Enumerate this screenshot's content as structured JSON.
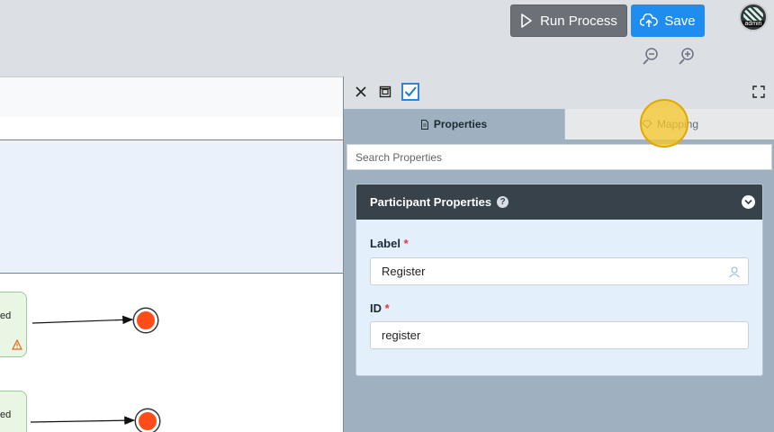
{
  "toolbar": {
    "run_label": "Run Process",
    "save_label": "Save",
    "avatar_label": "admin",
    "zoom_out": "zoom-out-icon",
    "zoom_in": "zoom-in-icon"
  },
  "canvas": {
    "task1_label": "ed",
    "task2_label": "ed"
  },
  "panel": {
    "tabs": [
      {
        "label": "Properties",
        "icon": "document-icon",
        "active": true
      },
      {
        "label": "Mapping",
        "icon": "mapping-icon",
        "active": false
      }
    ],
    "search_placeholder": "Search Properties",
    "section_title": "Participant Properties",
    "fields": [
      {
        "label": "Label",
        "required": "*",
        "value": "Register"
      },
      {
        "label": "ID",
        "required": "*",
        "value": "register"
      }
    ]
  },
  "colors": {
    "save": "#1f8cf0",
    "run": "#6b7176",
    "card_header": "#37424a",
    "end_event": "#ff4d1a",
    "required": "#e53935"
  }
}
